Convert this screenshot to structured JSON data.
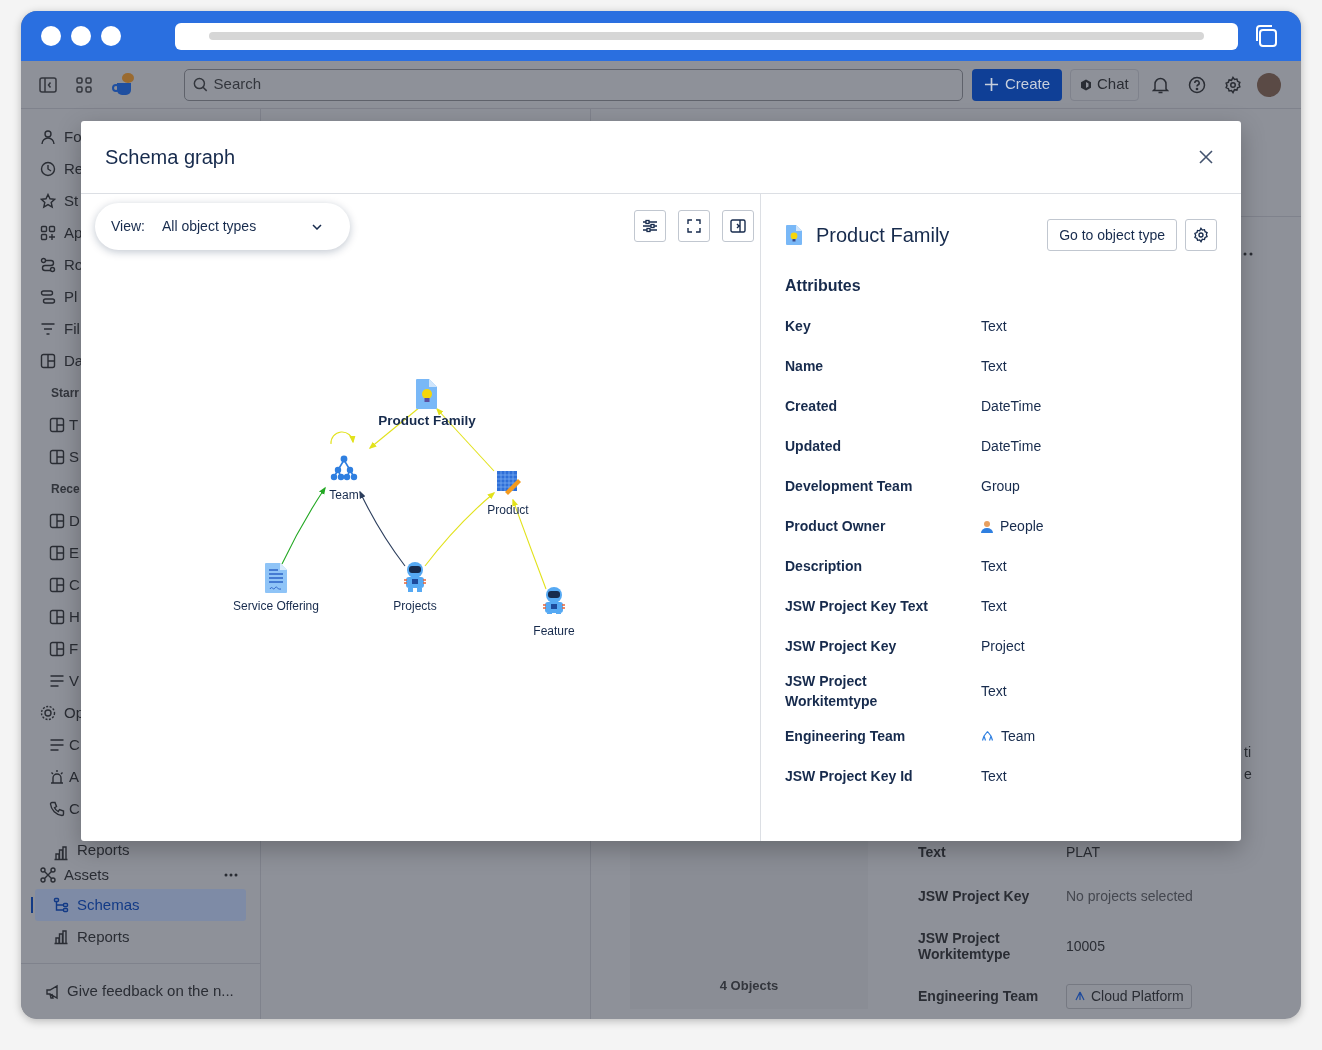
{
  "header": {
    "search": {
      "placeholder": "Search"
    },
    "create_button": "Create",
    "chat_button": "Chat"
  },
  "sidebar": {
    "items": [
      {
        "label": "Fo",
        "kind": "item",
        "selected": false
      },
      {
        "label": "Re",
        "kind": "item",
        "selected": false
      },
      {
        "label": "St",
        "kind": "item",
        "selected": false
      },
      {
        "label": "Ap",
        "kind": "item",
        "selected": false
      },
      {
        "label": "Ro",
        "kind": "item",
        "selected": false
      },
      {
        "label": "Pl",
        "kind": "item",
        "selected": false
      },
      {
        "label": "Fil",
        "kind": "item",
        "selected": false
      },
      {
        "label": "Da",
        "kind": "item",
        "selected": false
      },
      {
        "label": "Starr",
        "kind": "section"
      },
      {
        "label": "T",
        "kind": "subitem",
        "selected": false
      },
      {
        "label": "S",
        "kind": "subitem",
        "selected": false
      },
      {
        "label": "Rece",
        "kind": "section"
      },
      {
        "label": "D",
        "kind": "subitem",
        "selected": false
      },
      {
        "label": "E",
        "kind": "subitem",
        "selected": false
      },
      {
        "label": "C",
        "kind": "subitem",
        "selected": false
      },
      {
        "label": "H",
        "kind": "subitem",
        "selected": false
      },
      {
        "label": "F",
        "kind": "subitem",
        "selected": false
      },
      {
        "label": "V",
        "kind": "subitem",
        "selected": false
      },
      {
        "label": "Op",
        "kind": "item",
        "selected": false
      },
      {
        "label": "C",
        "kind": "subitem",
        "selected": false
      },
      {
        "label": "A",
        "kind": "subitem",
        "selected": false
      },
      {
        "label": "C",
        "kind": "subitem",
        "selected": false
      },
      {
        "label": "Reports",
        "kind": "subitem",
        "selected": false
      },
      {
        "label": "Assets",
        "kind": "item",
        "selected": false
      },
      {
        "label": "Schemas",
        "kind": "subitem",
        "selected": true
      },
      {
        "label": "Reports",
        "kind": "subitem",
        "selected": false
      }
    ],
    "feedback": "Give feedback on the n..."
  },
  "background": {
    "objects_count": "4 Objects",
    "side_fragment": [
      "ti",
      "e"
    ],
    "rows": [
      {
        "label": "Text",
        "value": "PLAT",
        "kind": "plain"
      },
      {
        "label": "JSW Project Key",
        "value": "No projects selected",
        "kind": "muted"
      },
      {
        "label": "JSW Project Workitemtype",
        "value": "10005",
        "kind": "plain"
      },
      {
        "label": "Engineering Team",
        "value": "Cloud Platform",
        "kind": "chip"
      }
    ]
  },
  "dialog": {
    "title": "Schema graph",
    "view": {
      "label": "View:",
      "value": "All object types"
    },
    "graph": {
      "nodes": [
        {
          "label": "Product Family",
          "kind": "idea-doc",
          "selected": true
        },
        {
          "label": "Team",
          "kind": "team",
          "selected": false
        },
        {
          "label": "Product",
          "kind": "blueprint",
          "selected": false
        },
        {
          "label": "Service Offering",
          "kind": "doc",
          "selected": false
        },
        {
          "label": "Projects",
          "kind": "astronaut",
          "selected": false
        },
        {
          "label": "Feature",
          "kind": "astronaut",
          "selected": false
        }
      ],
      "edges": [
        {
          "color": "#e2e21c"
        },
        {
          "color": "#e2e21c"
        },
        {
          "color": "#23a823"
        },
        {
          "color": "#2c3e5d"
        },
        {
          "color": "#e2e21c"
        },
        {
          "color": "#e2e21c"
        },
        {
          "color": "#e2e21c"
        }
      ]
    },
    "details": {
      "title": "Product Family",
      "go_button": "Go to object type",
      "section": "Attributes",
      "attributes": [
        {
          "name": "Key",
          "type": "Text",
          "kind": "plain"
        },
        {
          "name": "Name",
          "type": "Text",
          "kind": "plain"
        },
        {
          "name": "Created",
          "type": "DateTime",
          "kind": "plain"
        },
        {
          "name": "Updated",
          "type": "DateTime",
          "kind": "plain"
        },
        {
          "name": "Development Team",
          "type": "Group",
          "kind": "plain"
        },
        {
          "name": "Product Owner",
          "type": "People",
          "kind": "user"
        },
        {
          "name": "Description",
          "type": "Text",
          "kind": "plain"
        },
        {
          "name": "JSW Project Key Text",
          "type": "Text",
          "kind": "plain"
        },
        {
          "name": "JSW Project Key",
          "type": "Project",
          "kind": "plain"
        },
        {
          "name": "JSW Project Workitemtype",
          "type": "Text",
          "kind": "plain"
        },
        {
          "name": "Engineering Team",
          "type": "Team",
          "kind": "team"
        },
        {
          "name": "JSW Project Key Id",
          "type": "Text",
          "kind": "plain"
        }
      ]
    }
  }
}
